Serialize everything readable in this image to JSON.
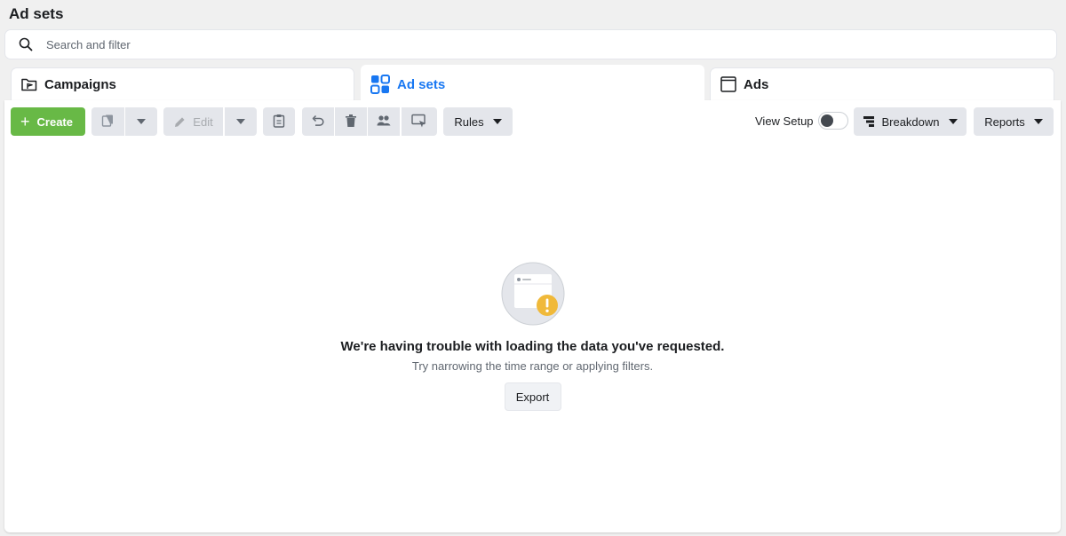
{
  "header": {
    "title": "Ad sets"
  },
  "search": {
    "placeholder": "Search and filter"
  },
  "tabs": [
    {
      "label": "Campaigns",
      "icon": "folder-flag-icon"
    },
    {
      "label": "Ad sets",
      "icon": "grid-icon",
      "active": true
    },
    {
      "label": "Ads",
      "icon": "window-icon"
    }
  ],
  "toolbar": {
    "create_label": "Create",
    "edit_label": "Edit",
    "rules_label": "Rules",
    "view_setup_label": "View Setup",
    "view_setup_on": false,
    "breakdown_label": "Breakdown",
    "reports_label": "Reports",
    "icons": [
      "duplicate-icon",
      "dropdown-icon",
      "edit-icon",
      "dropdown-icon",
      "clipboard-icon",
      "undo-icon",
      "trash-icon",
      "audience-icon",
      "preview-icon"
    ]
  },
  "empty_state": {
    "title": "We're having trouble with loading the data you've requested.",
    "subtitle": "Try narrowing the time range or applying filters.",
    "export_label": "Export"
  },
  "colors": {
    "accent_blue": "#1877f2",
    "create_green": "#68b946",
    "warning_yellow": "#f0b93a"
  }
}
